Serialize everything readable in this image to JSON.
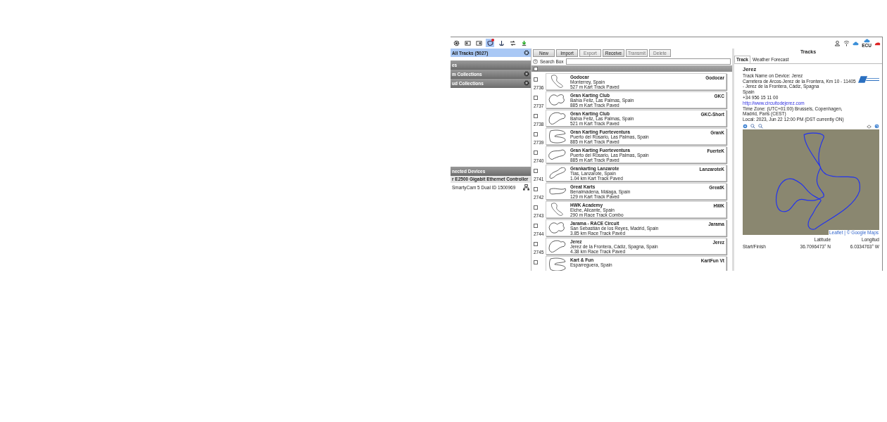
{
  "toolbar": {
    "left_icons": [
      {
        "kind": "gear",
        "selected": false
      },
      {
        "kind": "card",
        "selected": false
      },
      {
        "kind": "card2",
        "selected": false
      },
      {
        "kind": "tracks",
        "selected": true,
        "badge": true
      },
      {
        "kind": "anchor",
        "selected": false
      },
      {
        "kind": "sync",
        "selected": false
      },
      {
        "kind": "download",
        "selected": false
      }
    ],
    "right_icons": [
      {
        "kind": "user"
      },
      {
        "kind": "wifi"
      },
      {
        "kind": "cloud"
      },
      {
        "kind": "cloud",
        "label": "ECU"
      },
      {
        "kind": "car"
      }
    ]
  },
  "sidebar": {
    "all_tracks": {
      "label": "All Tracks  (5027)",
      "selected": true
    },
    "sections": [
      {
        "label": "es",
        "gear": false
      },
      {
        "label": "m Collections",
        "gear": true
      },
      {
        "label": "ud Collections",
        "gear": true
      }
    ],
    "devices_header": "nected Devices",
    "adapter": "r E2500 Gigabit Ethernet Controller",
    "device": "SmartyCam 5 Dual ID 1500969"
  },
  "buttons": [
    {
      "label": "New",
      "disabled": false
    },
    {
      "label": "Import",
      "disabled": false
    },
    {
      "label": "Export",
      "disabled": true
    },
    {
      "label": "Receive",
      "disabled": false
    },
    {
      "label": "Transmit",
      "disabled": true
    },
    {
      "label": "Delete",
      "disabled": true
    }
  ],
  "search": {
    "label": "Search Box"
  },
  "select_all": {
    "checked": false
  },
  "tracks": [
    {
      "number": "2736",
      "name": "Godocar",
      "location": "Monterrey, Spain",
      "info": "527 m Kart Track Paved",
      "short": "Godocar",
      "checked": false
    },
    {
      "number": "2737",
      "name": "Gran Karting Club",
      "location": "Bahía Feliz, Las Palmas, Spain",
      "info": "885 m Kart Track Paved",
      "short": "GKC",
      "checked": false
    },
    {
      "number": "2738",
      "name": "Gran Karting Club",
      "location": "Bahía Feliz, Las Palmas, Spain",
      "info": "521 m Kart Track Paved",
      "short": "GKC-Short",
      "checked": false
    },
    {
      "number": "2739",
      "name": "Gran Karting Fuerteventura",
      "location": "Puerto del Rosario, Las Palmas, Spain",
      "info": "885 m Kart Track Paved",
      "short": "GranK",
      "checked": false
    },
    {
      "number": "2740",
      "name": "Gran Karting Fuerteventura",
      "location": "Puerto del Rosario, Las Palmas, Spain",
      "info": "885 m Kart Track Paved",
      "short": "FuerteK",
      "checked": false
    },
    {
      "number": "2741",
      "name": "Grankarting Lanzarote",
      "location": "Tias, Lanzarote, Spain",
      "info": "1.04 km Kart Track Paved",
      "short": "LanzaroteK",
      "checked": false
    },
    {
      "number": "2742",
      "name": "Great Karts",
      "location": "Benalmádena, Málaga, Spain",
      "info": "129 m Kart Track Paved",
      "short": "GreatK",
      "checked": false
    },
    {
      "number": "2743",
      "name": "HWK Academy",
      "location": "Elche, Alicante, Spain",
      "info": "290 m Race Track Combo",
      "short": "HWK",
      "checked": false
    },
    {
      "number": "2744",
      "name": "Jarama - RACE Circuit",
      "location": "San Sebastián de los Reyes, Madrid, Spain",
      "info": "3.85 km Race Track Paved",
      "short": "Jarama",
      "checked": false
    },
    {
      "number": "2745",
      "name": "Jerez",
      "location": "Jerez de la Frontera, Cádiz, Spagna, Spain",
      "info": "4.38 km Race Track Paved",
      "short": "Jerez",
      "checked": false
    },
    {
      "name": "Kart & Fun",
      "location": "Esparreguera, Spain",
      "short": "KartFun Vt",
      "checked": false
    }
  ],
  "detail": {
    "title": "Tracks",
    "tabs": [
      {
        "label": "Track",
        "selected": true
      },
      {
        "label": "Weather Forecast",
        "selected": false
      }
    ],
    "name": "Jerez",
    "lines": [
      "Track Name on Device: Jerez",
      "Carretera de Arcos-Jerez de la Frontera, Km 10 - 11405 - Jerez de la Frontera, Cádiz, Spagna",
      "Spain",
      "+34 956 15 11 00"
    ],
    "link": "http://www.circuitodejerez.com",
    "lines2": [
      "Time Zone: (UTC+01:00) Brussels, Copenhagen, Madrid, Paris (CEST)",
      "Local: 2023, Jun 22 12:00 PM (DST currently ON)"
    ],
    "map_attribution": "Leaflet | © Google Maps",
    "columns": [
      "Latitude",
      "Longitud"
    ],
    "rows": [
      {
        "name": "Start/Finish",
        "lat": "36.7096473° N",
        "lon": "6.0334763° W"
      }
    ]
  }
}
